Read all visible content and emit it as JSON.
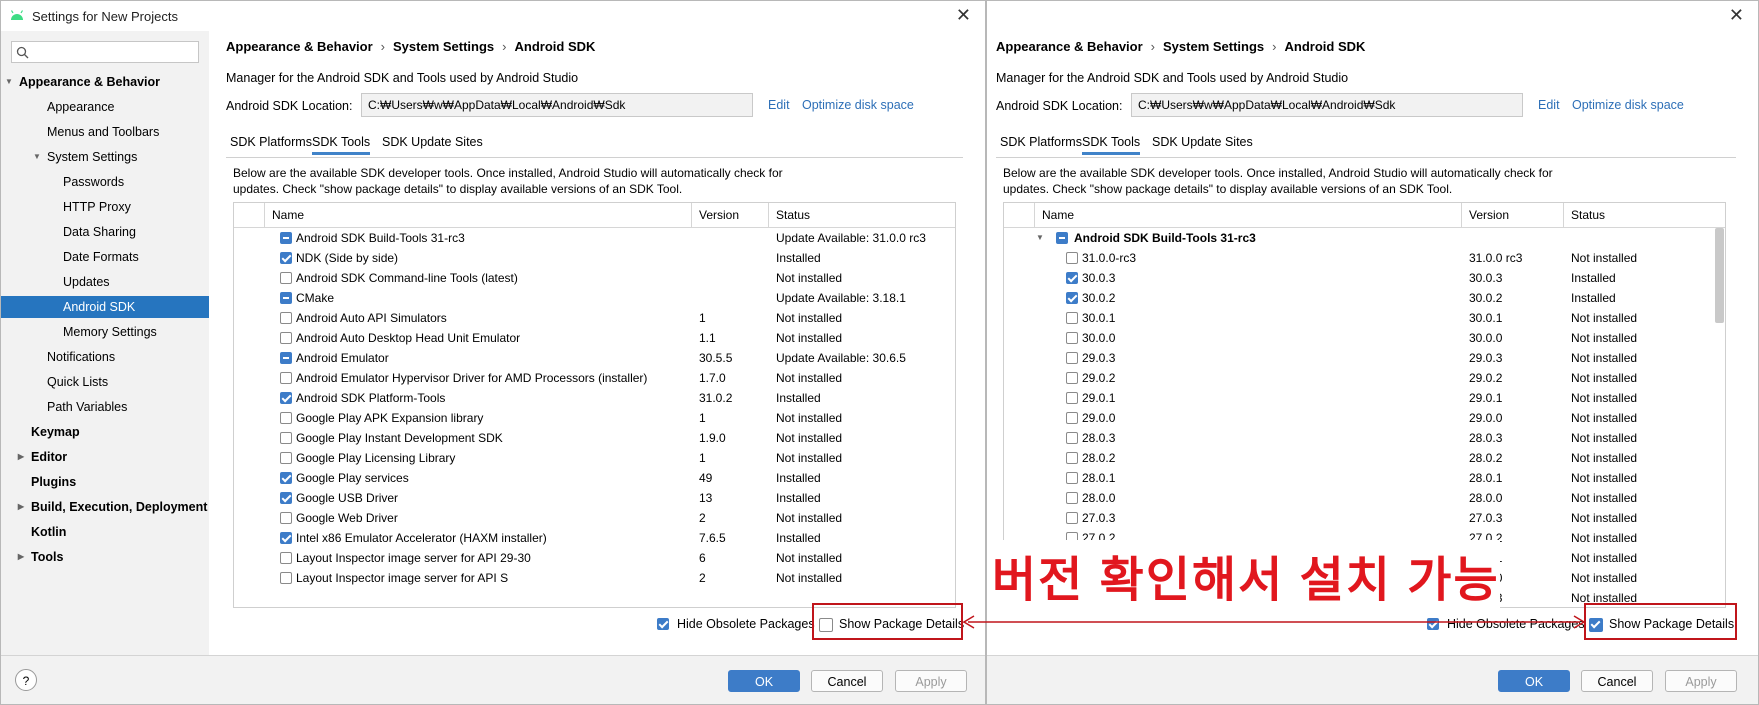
{
  "left": {
    "title": "Settings for New Projects",
    "search_placeholder": "",
    "tree": [
      {
        "label": "Appearance & Behavior",
        "bold": true,
        "arrow": "▼"
      },
      {
        "label": "Appearance"
      },
      {
        "label": "Menus and Toolbars"
      },
      {
        "label": "System Settings",
        "arrow": "▼"
      },
      {
        "label": "Passwords"
      },
      {
        "label": "HTTP Proxy"
      },
      {
        "label": "Data Sharing"
      },
      {
        "label": "Date Formats"
      },
      {
        "label": "Updates"
      },
      {
        "label": "Android SDK",
        "selected": true
      },
      {
        "label": "Memory Settings"
      },
      {
        "label": "Notifications"
      },
      {
        "label": "Quick Lists"
      },
      {
        "label": "Path Variables"
      },
      {
        "label": "Keymap",
        "bold": true
      },
      {
        "label": "Editor",
        "bold": true,
        "arrow": "▶"
      },
      {
        "label": "Plugins",
        "bold": true
      },
      {
        "label": "Build, Execution, Deployment",
        "bold": true,
        "arrow": "▶"
      },
      {
        "label": "Kotlin",
        "bold": true
      },
      {
        "label": "Tools",
        "bold": true,
        "arrow": "▶"
      }
    ],
    "breadcrumb": [
      "Appearance & Behavior",
      "System Settings",
      "Android SDK"
    ],
    "manager_desc": "Manager for the Android SDK and Tools used by Android Studio",
    "location_label": "Android SDK Location:",
    "location_value": "C:₩Users₩w₩AppData₩Local₩Android₩Sdk",
    "edit_link": "Edit",
    "optimize_link": "Optimize disk space",
    "tabs": [
      "SDK Platforms",
      "SDK Tools",
      "SDK Update Sites"
    ],
    "info": "Below are the available SDK developer tools. Once installed, Android Studio will automatically check for updates. Check \"show package details\" to display available versions of an SDK Tool.",
    "columns": [
      "Name",
      "Version",
      "Status"
    ],
    "rows": [
      {
        "state": "partial",
        "name": "Android SDK Build-Tools 31-rc3",
        "version": "",
        "status": "Update Available: 31.0.0 rc3"
      },
      {
        "state": "checked",
        "name": "NDK (Side by side)",
        "version": "",
        "status": "Installed"
      },
      {
        "state": "none",
        "name": "Android SDK Command-line Tools (latest)",
        "version": "",
        "status": "Not installed"
      },
      {
        "state": "partial",
        "name": "CMake",
        "version": "",
        "status": "Update Available: 3.18.1"
      },
      {
        "state": "none",
        "name": "Android Auto API Simulators",
        "version": "1",
        "status": "Not installed"
      },
      {
        "state": "none",
        "name": "Android Auto Desktop Head Unit Emulator",
        "version": "1.1",
        "status": "Not installed"
      },
      {
        "state": "partial",
        "name": "Android Emulator",
        "version": "30.5.5",
        "status": "Update Available: 30.6.5"
      },
      {
        "state": "none",
        "name": "Android Emulator Hypervisor Driver for AMD Processors (installer)",
        "version": "1.7.0",
        "status": "Not installed"
      },
      {
        "state": "checked",
        "name": "Android SDK Platform-Tools",
        "version": "31.0.2",
        "status": "Installed"
      },
      {
        "state": "none",
        "name": "Google Play APK Expansion library",
        "version": "1",
        "status": "Not installed"
      },
      {
        "state": "none",
        "name": "Google Play Instant Development SDK",
        "version": "1.9.0",
        "status": "Not installed"
      },
      {
        "state": "none",
        "name": "Google Play Licensing Library",
        "version": "1",
        "status": "Not installed"
      },
      {
        "state": "checked",
        "name": "Google Play services",
        "version": "49",
        "status": "Installed"
      },
      {
        "state": "checked",
        "name": "Google USB Driver",
        "version": "13",
        "status": "Installed"
      },
      {
        "state": "none",
        "name": "Google Web Driver",
        "version": "2",
        "status": "Not installed"
      },
      {
        "state": "checked",
        "name": "Intel x86 Emulator Accelerator (HAXM installer)",
        "version": "7.6.5",
        "status": "Installed"
      },
      {
        "state": "none",
        "name": "Layout Inspector image server for API 29-30",
        "version": "6",
        "status": "Not installed"
      },
      {
        "state": "none",
        "name": "Layout Inspector image server for API S",
        "version": "2",
        "status": "Not installed"
      }
    ],
    "hide_obsolete": {
      "label": "Hide Obsolete Packages",
      "checked": true
    },
    "show_details": {
      "label": "Show Package Details",
      "checked": false
    },
    "buttons": {
      "help": "?",
      "ok": "OK",
      "cancel": "Cancel",
      "apply": "Apply"
    }
  },
  "right": {
    "breadcrumb": [
      "Appearance & Behavior",
      "System Settings",
      "Android SDK"
    ],
    "manager_desc": "Manager for the Android SDK and Tools used by Android Studio",
    "location_label": "Android SDK Location:",
    "location_value": "C:₩Users₩w₩AppData₩Local₩Android₩Sdk",
    "edit_link": "Edit",
    "optimize_link": "Optimize disk space",
    "tabs": [
      "SDK Platforms",
      "SDK Tools",
      "SDK Update Sites"
    ],
    "info": "Below are the available SDK developer tools. Once installed, Android Studio will automatically check for updates. Check \"show package details\" to display available versions of an SDK Tool.",
    "columns": [
      "Name",
      "Version",
      "Status"
    ],
    "group": {
      "name": "Android SDK Build-Tools 31-rc3",
      "state": "partial"
    },
    "rows": [
      {
        "state": "none",
        "name": "31.0.0-rc3",
        "version": "31.0.0 rc3",
        "status": "Not installed"
      },
      {
        "state": "checked",
        "name": "30.0.3",
        "version": "30.0.3",
        "status": "Installed"
      },
      {
        "state": "checked",
        "name": "30.0.2",
        "version": "30.0.2",
        "status": "Installed"
      },
      {
        "state": "none",
        "name": "30.0.1",
        "version": "30.0.1",
        "status": "Not installed"
      },
      {
        "state": "none",
        "name": "30.0.0",
        "version": "30.0.0",
        "status": "Not installed"
      },
      {
        "state": "none",
        "name": "29.0.3",
        "version": "29.0.3",
        "status": "Not installed"
      },
      {
        "state": "none",
        "name": "29.0.2",
        "version": "29.0.2",
        "status": "Not installed"
      },
      {
        "state": "none",
        "name": "29.0.1",
        "version": "29.0.1",
        "status": "Not installed"
      },
      {
        "state": "none",
        "name": "29.0.0",
        "version": "29.0.0",
        "status": "Not installed"
      },
      {
        "state": "none",
        "name": "28.0.3",
        "version": "28.0.3",
        "status": "Not installed"
      },
      {
        "state": "none",
        "name": "28.0.2",
        "version": "28.0.2",
        "status": "Not installed"
      },
      {
        "state": "none",
        "name": "28.0.1",
        "version": "28.0.1",
        "status": "Not installed"
      },
      {
        "state": "none",
        "name": "28.0.0",
        "version": "28.0.0",
        "status": "Not installed"
      },
      {
        "state": "none",
        "name": "27.0.3",
        "version": "27.0.3",
        "status": "Not installed"
      },
      {
        "state": "none",
        "name": "27.0.2",
        "version": "27.0.2",
        "status": "Not installed"
      },
      {
        "state": "none",
        "name": "27.0.1",
        "version": "27.0.1",
        "status": "Not installed"
      },
      {
        "state": "none",
        "name": "27.0.0",
        "version": "27.0.0",
        "status": "Not installed"
      },
      {
        "state": "none",
        "name": "26.0.3",
        "version": "26.0.3",
        "status": "Not installed"
      }
    ],
    "hide_obsolete": {
      "label": "Hide Obsolete Packages",
      "checked": true
    },
    "show_details": {
      "label": "Show Package Details",
      "checked": true
    },
    "buttons": {
      "ok": "OK",
      "cancel": "Cancel",
      "apply": "Apply"
    }
  },
  "annotation": {
    "text": "버전 확인해서 설치 가능",
    "color": "#e1171e"
  }
}
